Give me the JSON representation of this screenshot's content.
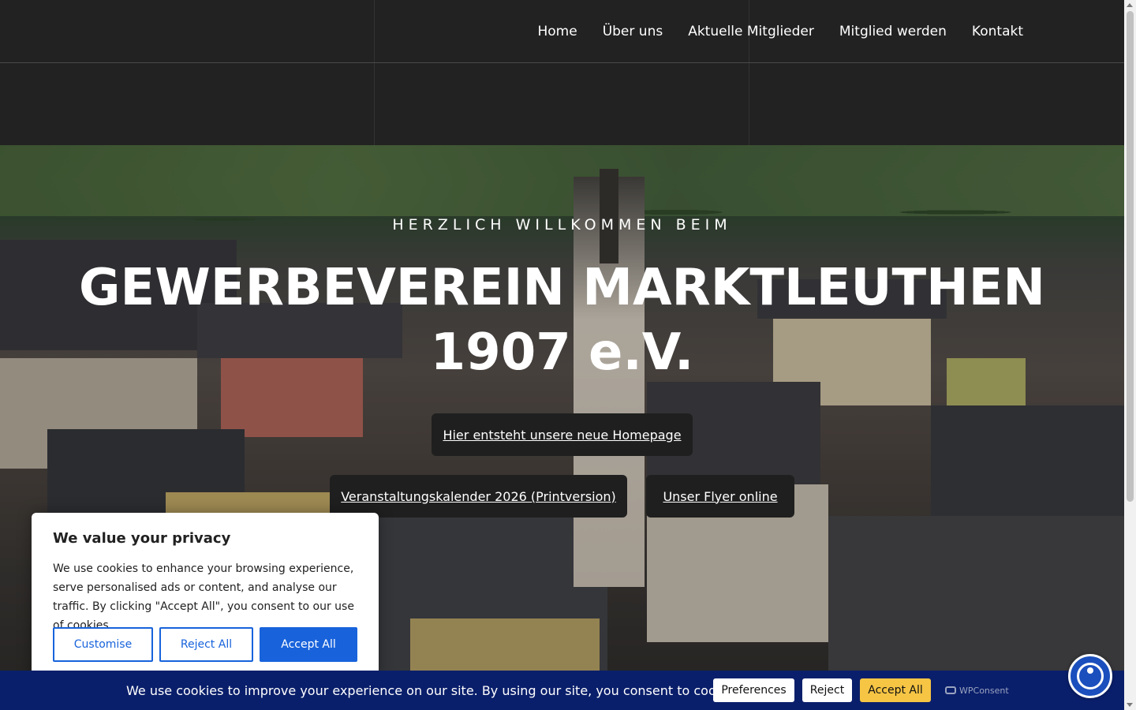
{
  "nav": {
    "items": [
      "Home",
      "Über uns",
      "Aktuelle Mitglieder",
      "Mitglied werden",
      "Kontakt"
    ]
  },
  "hero": {
    "subtitle": "HERZLICH WILLKOMMEN BEIM",
    "title": "GEWERBEVEREIN MARKTLEUTHEN 1907 e.V.",
    "buttons": {
      "homepage": "Hier entsteht unsere neue Homepage",
      "calendar": "Veranstaltungskalender 2026 (Printversion)",
      "flyer": "Unser Flyer online"
    }
  },
  "privacy_modal": {
    "title": "We value your privacy",
    "text": "We use cookies to enhance your browsing experience, serve personalised ads or content, and analyse our traffic. By clicking \"Accept All\", you consent to our use of cookies.",
    "customise": "Customise",
    "reject_all": "Reject All",
    "accept_all": "Accept All"
  },
  "cookie_bar": {
    "message": "We use cookies to improve your experience on our site. By using our site, you consent to cookies.",
    "preferences": "Preferences",
    "reject": "Reject",
    "accept_all": "Accept All",
    "brand": "WPConsent"
  },
  "colors": {
    "header_bg": "#222222",
    "button_dark": "#1f1f1f",
    "privacy_blue": "#1863dc",
    "cookiebar_bg": "#0a1f6b",
    "accept_yellow": "#f6c544",
    "a11y_blue": "#1b4fbd"
  },
  "icons": [
    "accessibility-icon",
    "wpconsent-logo-icon",
    "scroll-up-arrow-icon",
    "scroll-down-arrow-icon"
  ]
}
